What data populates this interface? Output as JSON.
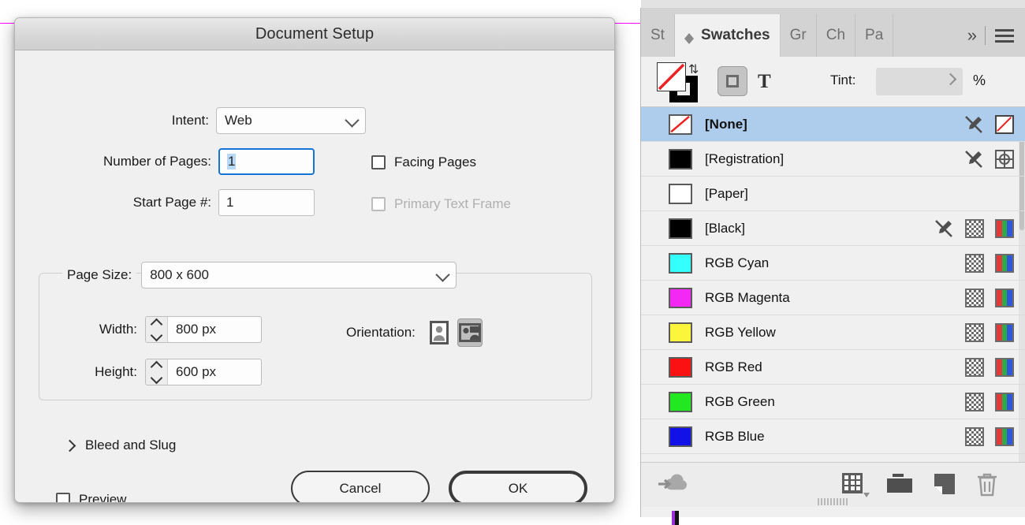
{
  "dialog": {
    "title": "Document Setup",
    "fields": {
      "intent_label": "Intent:",
      "intent_value": "Web",
      "pages_label": "Number of Pages:",
      "pages_value": "1",
      "start_page_label": "Start Page #:",
      "start_page_value": "1",
      "facing_pages_label": "Facing Pages",
      "primary_text_frame_label": "Primary Text Frame",
      "page_size_label": "Page Size:",
      "page_size_value": "800 x 600",
      "width_label": "Width:",
      "width_value": "800 px",
      "height_label": "Height:",
      "height_value": "600 px",
      "orientation_label": "Orientation:",
      "bleed_and_slug_label": "Bleed and Slug",
      "preview_label": "Preview"
    },
    "buttons": {
      "cancel": "Cancel",
      "ok": "OK"
    }
  },
  "panel": {
    "tabs": [
      {
        "label": "St",
        "active": false
      },
      {
        "label": "Swatches",
        "active": true
      },
      {
        "label": "Gr",
        "active": false
      },
      {
        "label": "Ch",
        "active": false
      },
      {
        "label": "Pa",
        "active": false
      }
    ],
    "overflow_label": "»",
    "toolbar": {
      "tint_label": "Tint:",
      "tint_value": "",
      "tint_unit": "%"
    },
    "swatches": [
      {
        "name": "[None]",
        "color": "none",
        "selected": true,
        "bold": true,
        "lock": true,
        "mode": "none"
      },
      {
        "name": "[Registration]",
        "color": "#000000",
        "selected": false,
        "bold": false,
        "lock": true,
        "mode": "registration"
      },
      {
        "name": "[Paper]",
        "color": "#ffffff",
        "selected": false,
        "bold": false,
        "lock": false,
        "mode": ""
      },
      {
        "name": "[Black]",
        "color": "#000000",
        "selected": false,
        "bold": false,
        "lock": true,
        "mode": "tint-rgb"
      },
      {
        "name": "RGB Cyan",
        "color": "#33ffff",
        "selected": false,
        "bold": false,
        "lock": false,
        "mode": "tint-rgb"
      },
      {
        "name": "RGB Magenta",
        "color": "#f428f4",
        "selected": false,
        "bold": false,
        "lock": false,
        "mode": "tint-rgb"
      },
      {
        "name": "RGB Yellow",
        "color": "#fbf53c",
        "selected": false,
        "bold": false,
        "lock": false,
        "mode": "tint-rgb"
      },
      {
        "name": "RGB Red",
        "color": "#fb1111",
        "selected": false,
        "bold": false,
        "lock": false,
        "mode": "tint-rgb"
      },
      {
        "name": "RGB Green",
        "color": "#22e822",
        "selected": false,
        "bold": false,
        "lock": false,
        "mode": "tint-rgb"
      },
      {
        "name": "RGB Blue",
        "color": "#1111e8",
        "selected": false,
        "bold": false,
        "lock": false,
        "mode": "tint-rgb"
      }
    ],
    "footer_icons": [
      "cloud-upload-icon",
      "new-color-group-icon",
      "folder-icon",
      "new-swatch-icon",
      "delete-swatch-icon"
    ]
  },
  "colors": {
    "guide_magenta": "#ff00ff",
    "selection_blue": "#aecdec",
    "focus_blue": "#1673d6"
  }
}
